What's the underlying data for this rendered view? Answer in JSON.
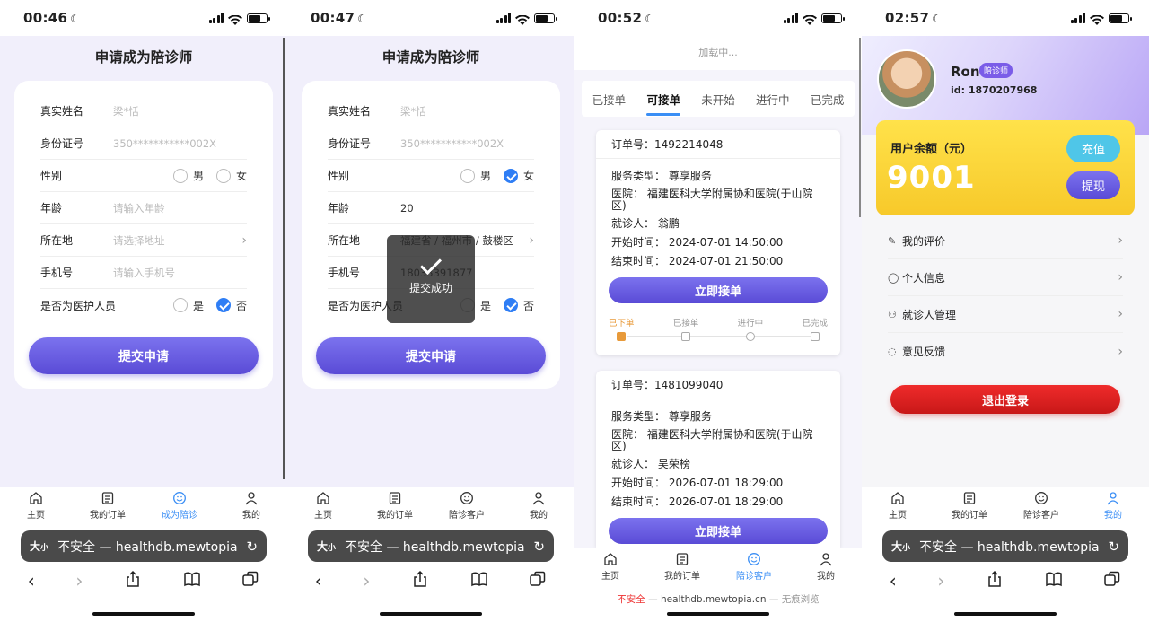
{
  "screens": [
    {
      "time": "00:46",
      "title": "申请成为陪诊师",
      "fields": [
        {
          "label": "真实姓名",
          "value": "梁*恬"
        },
        {
          "label": "身份证号",
          "value": "350***********002X"
        },
        {
          "label": "性别"
        },
        {
          "label": "年龄",
          "value": "请输入年龄"
        },
        {
          "label": "所在地",
          "value": "请选择地址"
        },
        {
          "label": "手机号",
          "value": "请输入手机号"
        },
        {
          "label": "是否为医护人员"
        }
      ],
      "gender_options": [
        "男",
        "女"
      ],
      "medical_options": [
        "是",
        "否"
      ],
      "submit": "提交申请",
      "tabs": [
        "主页",
        "我的订单",
        "成为陪诊",
        "我的"
      ],
      "url": "不安全 — healthdb.mewtopia.cn"
    },
    {
      "time": "00:47",
      "title": "申请成为陪诊师",
      "fields": [
        {
          "label": "真实姓名",
          "value": "梁*恬"
        },
        {
          "label": "身份证号",
          "value": "350***********002X"
        },
        {
          "label": "性别"
        },
        {
          "label": "年龄",
          "value": "20"
        },
        {
          "label": "所在地",
          "value": "福建省 / 福州市 / 鼓楼区"
        },
        {
          "label": "手机号",
          "value": "18033391877"
        },
        {
          "label": "是否为医护人员"
        }
      ],
      "gender_options": [
        "男",
        "女"
      ],
      "medical_options": [
        "是",
        "否"
      ],
      "submit": "提交申请",
      "toast": "提交成功",
      "tabs": [
        "主页",
        "我的订单",
        "陪诊客户",
        "我的"
      ],
      "url": "不安全 — healthdb.mewtopia.cn"
    },
    {
      "time": "00:52",
      "loading": "加载中...",
      "order_tabs": [
        "已接单",
        "可接单",
        "未开始",
        "进行中",
        "已完成"
      ],
      "orders": [
        {
          "no": "订单号：1492214048",
          "type": "服务类型：  尊享服务",
          "hospital": "医院：  福建医科大学附属协和医院(于山院区)",
          "patient": "就诊人：  翁鹏",
          "start": "开始时间：  2024-07-01 14:50:00",
          "end": "结束时间：  2024-07-01 21:50:00",
          "button": "立即接单",
          "steps": [
            "已下单",
            "已接单",
            "进行中",
            "已完成"
          ]
        },
        {
          "no": "订单号：1481099040",
          "type": "服务类型：  尊享服务",
          "hospital": "医院：  福建医科大学附属协和医院(于山院区)",
          "patient": "就诊人：  吴荣榜",
          "start": "开始时间：  2026-07-01 18:29:00",
          "end": "结束时间：  2026-07-01 18:29:00",
          "button": "立即接单"
        }
      ],
      "tabs": [
        "主页",
        "我的订单",
        "陪诊客户",
        "我的"
      ],
      "url_parts": {
        "insecure": "不安全",
        "host": "healthdb.mewtopia.cn",
        "private": "无痕浏览"
      }
    },
    {
      "time": "02:57",
      "name": "Ron",
      "badge": "陪诊师",
      "id": "id: 1870207968",
      "balance_label": "用户余额（元）",
      "balance_value": "9001",
      "recharge": "充值",
      "withdraw": "提现",
      "menu": [
        "我的评价",
        "个人信息",
        "就诊人管理",
        "意见反馈"
      ],
      "logout": "退出登录",
      "tabs": [
        "主页",
        "我的订单",
        "陪诊客户",
        "我的"
      ],
      "url": "不安全 — healthdb.mewtopia.cn"
    }
  ],
  "colors": {
    "accent": "#5a4bd6",
    "blue": "#3a8ef5",
    "orange": "#e89a3a",
    "red": "#d91f1f",
    "yellow": "#f7c92a"
  }
}
